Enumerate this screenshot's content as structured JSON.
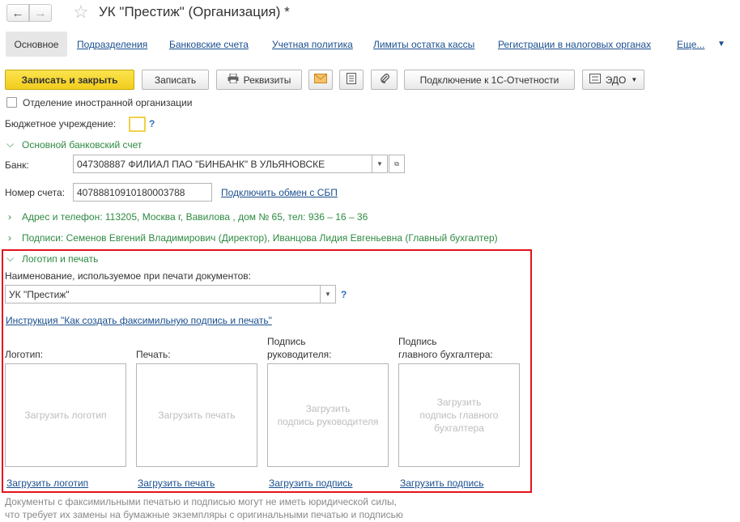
{
  "window": {
    "title": "УК \"Престиж\" (Организация) *"
  },
  "nav": {
    "back_icon": "←",
    "forward_icon": "→",
    "star_icon": "☆"
  },
  "tabs": {
    "active": "Основное",
    "links": [
      "Подразделения",
      "Банковские счета",
      "Учетная политика",
      "Лимиты остатка кассы",
      "Регистрации в налоговых органах",
      "Еще..."
    ]
  },
  "toolbar": {
    "save_close": "Записать и закрыть",
    "save": "Записать",
    "requisites": "Реквизиты",
    "connect_1c": "Подключение к 1С-Отчетности",
    "edo": "ЭДО"
  },
  "form": {
    "foreign_branch": "Отделение иностранной организации",
    "budget_label": "Бюджетное учреждение:",
    "help": "?",
    "bank_section": "Основной банковский счет",
    "bank_label": "Банк:",
    "bank_value": "047308887 ФИЛИАЛ ПАО \"БИНБАНК\" В УЛЬЯНОВСКЕ",
    "account_label": "Номер счета:",
    "account_value": "40788810910180003788",
    "sbp_link": "Подключить обмен с СБП",
    "address_section": "Адрес и телефон: 113205, Москва г, Вавилова , дом № 65, тел: 936 – 16 – 36",
    "signatures_section": "Подписи: Семенов Евгений Владимирович (Директор), Иванцова Лидия Евгеньевна (Главный бухгалтер)"
  },
  "logo": {
    "section": "Логотип и печать",
    "name_label": "Наименование, используемое при печати документов:",
    "name_value": "УК \"Престиж\"",
    "instruction_link": "Инструкция \"Как создать факсимильную подпись и печать\"",
    "labels": {
      "logo": "Логотип:",
      "stamp": "Печать:",
      "head_sig_1": "Подпись",
      "head_sig_2": "руководителя:",
      "acc_sig_1": "Подпись",
      "acc_sig_2": "главного бухгалтера:"
    },
    "placeholders": {
      "logo": "Загрузить логотип",
      "stamp": "Загрузить печать",
      "head_1": "Загрузить",
      "head_2": "подпись руководителя",
      "acc_1": "Загрузить",
      "acc_2": "подпись главного",
      "acc_3": "бухгалтера"
    },
    "upload_links": {
      "logo": "Загрузить логотип",
      "stamp": "Загрузить печать",
      "head": "Загрузить подпись",
      "acc": "Загрузить подпись"
    }
  },
  "footer_note": {
    "line1": "Документы с факсимильными печатью и подписью могут не иметь юридической силы,",
    "line2": "что требует их замены на бумажные экземпляры с оригинальными печатью и подписью"
  }
}
